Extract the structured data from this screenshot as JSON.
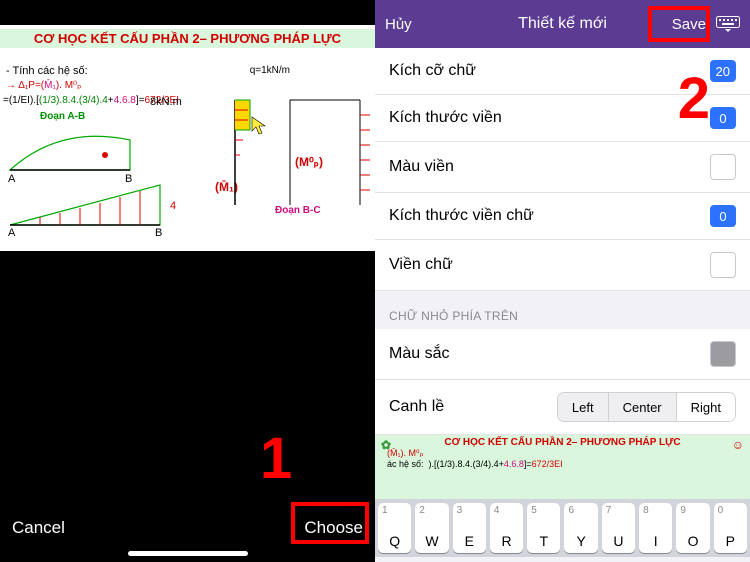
{
  "left": {
    "annotation": "1",
    "image": {
      "title": "CƠ HỌC KẾT CẤU PHẦN 2– PHƯƠNG PHÁP LỰC",
      "line1": "- Tính các hệ số:",
      "line2a": "→ Δ₁P=(",
      "line2b": "M̄₁",
      "line2c": "). M⁰ₚ",
      "line3": "=(1/EI).[(1/3).8.4.(3/4).4+4.6.8]=672/3EI",
      "seg_ab": "Đoạn A-B",
      "load": "8kN.m",
      "q": "q=1kN/m",
      "eight": "8kN.m",
      "m1": "(M̄₁)",
      "m0p": "(M⁰ₚ)",
      "seg_bc": "Đoạn B-C",
      "A": "A",
      "B": "B",
      "four": "4"
    },
    "cancel": "Cancel",
    "choose": "Choose"
  },
  "right": {
    "header": {
      "cancel": "Hủy",
      "title": "Thiết kế mới",
      "save": "Save"
    },
    "annotation": "2",
    "rows": {
      "font_size": {
        "label": "Kích cỡ chữ",
        "value": "20"
      },
      "border_size": {
        "label": "Kích thước viền",
        "value": "0"
      },
      "border_color": {
        "label": "Màu viền"
      },
      "text_border_size": {
        "label": "Kích thước viền chữ",
        "value": "0"
      },
      "text_border": {
        "label": "Viền chữ"
      }
    },
    "section": "CHỮ NHỎ PHÍA TRÊN",
    "rows2": {
      "color": {
        "label": "Màu sắc"
      },
      "align": {
        "label": "Canh lề",
        "opts": [
          "Left",
          "Center",
          "Right"
        ],
        "active": 2
      }
    },
    "preview": {
      "title": "CƠ HỌC KẾT CẤU PHẦN 2– PHƯƠNG PHÁP LỰC",
      "line2": "(M̄₁). M⁰ₚ",
      "line3": "ác hệ số:",
      "line4": ").[(1/3).8.4.(3/4).4+4.6.8]=672/3EI"
    },
    "keyboard": {
      "keys": [
        {
          "n": "1",
          "l": "Q"
        },
        {
          "n": "2",
          "l": "W"
        },
        {
          "n": "3",
          "l": "E"
        },
        {
          "n": "4",
          "l": "R"
        },
        {
          "n": "5",
          "l": "T"
        },
        {
          "n": "6",
          "l": "Y"
        },
        {
          "n": "7",
          "l": "U"
        },
        {
          "n": "8",
          "l": "I"
        },
        {
          "n": "9",
          "l": "O"
        },
        {
          "n": "0",
          "l": "P"
        }
      ]
    }
  }
}
